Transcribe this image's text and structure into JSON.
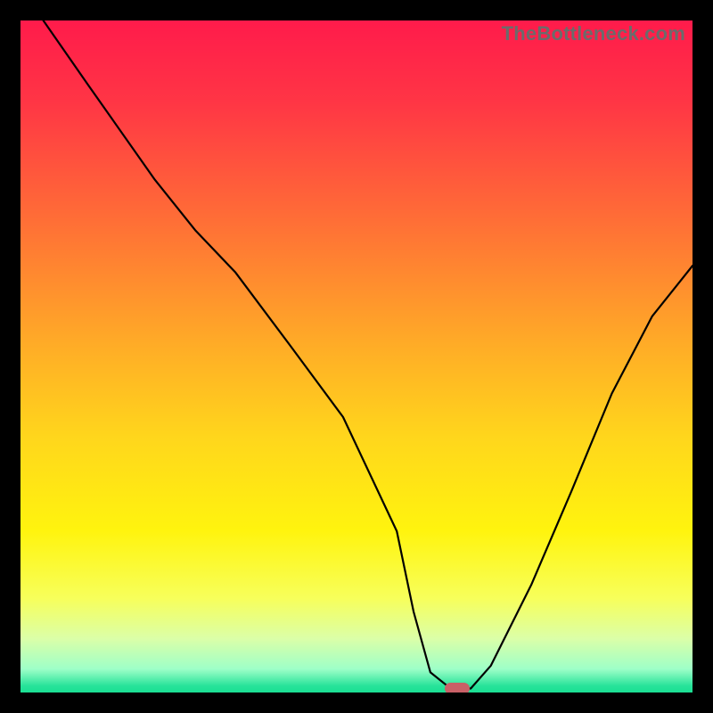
{
  "watermark": "TheBottleneck.com",
  "chart_data": {
    "type": "line",
    "title": "",
    "xlabel": "",
    "ylabel": "",
    "xlim": [
      0,
      100
    ],
    "ylim": [
      0,
      100
    ],
    "grid": false,
    "legend": false,
    "background_gradient": {
      "stops": [
        {
          "offset": 0.0,
          "color": "#ff1b4b"
        },
        {
          "offset": 0.12,
          "color": "#ff3545"
        },
        {
          "offset": 0.3,
          "color": "#ff6f36"
        },
        {
          "offset": 0.48,
          "color": "#ffab27"
        },
        {
          "offset": 0.62,
          "color": "#ffd61c"
        },
        {
          "offset": 0.76,
          "color": "#fff40e"
        },
        {
          "offset": 0.86,
          "color": "#f7ff5b"
        },
        {
          "offset": 0.92,
          "color": "#dbffa8"
        },
        {
          "offset": 0.965,
          "color": "#9effc8"
        },
        {
          "offset": 0.99,
          "color": "#28e39a"
        },
        {
          "offset": 1.0,
          "color": "#1adf93"
        }
      ]
    },
    "series": [
      {
        "name": "bottleneck-curve",
        "stroke": "#000000",
        "stroke_width": 2.2,
        "x": [
          3.4,
          10,
          20,
          26,
          32,
          40,
          48,
          56,
          58.5,
          61,
          64,
          67,
          70,
          76,
          82,
          88,
          94,
          100
        ],
        "y": [
          100,
          90.5,
          76.3,
          68.8,
          62.5,
          51.8,
          41.0,
          24.0,
          12.0,
          3.0,
          0.6,
          0.6,
          4.0,
          16.0,
          30.0,
          44.5,
          56.0,
          63.5
        ]
      }
    ],
    "marker": {
      "name": "optimal-point",
      "x": 65.0,
      "y": 0.6,
      "color": "#c96067",
      "shape": "pill"
    }
  }
}
